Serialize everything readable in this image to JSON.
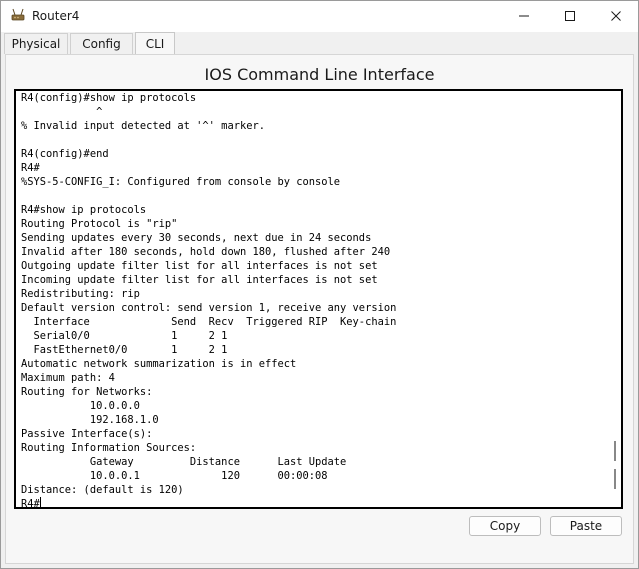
{
  "window": {
    "title": "Router4",
    "icons": {
      "app": "router-icon",
      "minimize": "minimize-icon",
      "maximize": "maximize-icon",
      "close": "close-icon"
    }
  },
  "tabs": [
    {
      "label": "Physical",
      "active": false
    },
    {
      "label": "Config",
      "active": false
    },
    {
      "label": "CLI",
      "active": true
    }
  ],
  "cli": {
    "heading": "IOS Command Line Interface",
    "lines": [
      "R4(config)#show ip protocols",
      "            ^",
      "% Invalid input detected at '^' marker.",
      "",
      "R4(config)#end",
      "R4#",
      "%SYS-5-CONFIG_I: Configured from console by console",
      "",
      "R4#show ip protocols",
      "Routing Protocol is \"rip\"",
      "Sending updates every 30 seconds, next due in 24 seconds",
      "Invalid after 180 seconds, hold down 180, flushed after 240",
      "Outgoing update filter list for all interfaces is not set",
      "Incoming update filter list for all interfaces is not set",
      "Redistributing: rip",
      "Default version control: send version 1, receive any version",
      "  Interface             Send  Recv  Triggered RIP  Key-chain",
      "  Serial0/0             1     2 1",
      "  FastEthernet0/0       1     2 1",
      "Automatic network summarization is in effect",
      "Maximum path: 4",
      "Routing for Networks:",
      "           10.0.0.0",
      "           192.168.1.0",
      "Passive Interface(s):",
      "Routing Information Sources:",
      "           Gateway         Distance      Last Update",
      "           10.0.0.1             120      00:00:08",
      "Distance: (default is 120)"
    ],
    "prompt": "R4#"
  },
  "buttons": {
    "copy": "Copy",
    "paste": "Paste"
  },
  "colors": {
    "window_bg": "#f0f0f0",
    "terminal_bg": "#ffffff",
    "terminal_text": "#000000"
  }
}
